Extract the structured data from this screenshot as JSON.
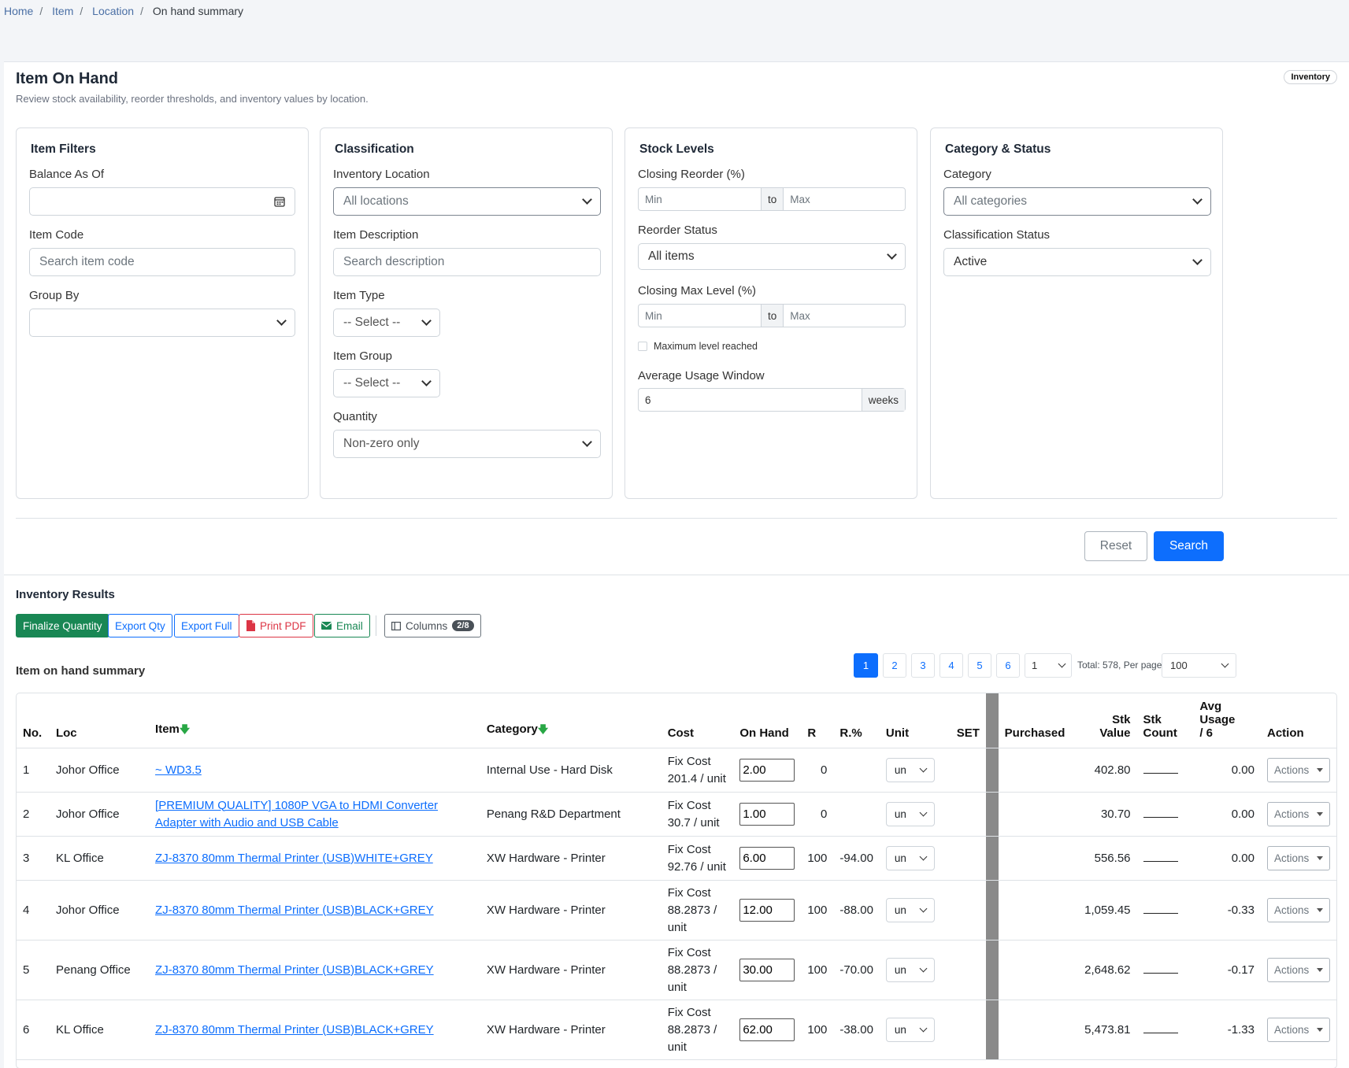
{
  "breadcrumb": [
    "Home",
    "Item",
    "Location",
    "On hand summary"
  ],
  "page": {
    "title": "Item On Hand",
    "subtitle": "Review stock availability, reorder thresholds, and inventory values by location.",
    "badge": "Inventory"
  },
  "filters": {
    "item": {
      "heading": "Item Filters",
      "balance_label": "Balance As Of",
      "balance_value": "",
      "code_label": "Item Code",
      "code_placeholder": "Search item code",
      "group_label": "Group By",
      "group_value": ""
    },
    "classification": {
      "heading": "Classification",
      "location_label": "Inventory Location",
      "location_value": "All locations",
      "desc_label": "Item Description",
      "desc_placeholder": "Search description",
      "type_label": "Item Type",
      "type_value": "-- Select --",
      "group_label": "Item Group",
      "group_value": "-- Select --",
      "qty_label": "Quantity",
      "qty_value": "Non-zero only"
    },
    "stock": {
      "heading": "Stock Levels",
      "reorder_label": "Closing Reorder (%)",
      "min": "Min",
      "to": "to",
      "max": "Max",
      "status_label": "Reorder Status",
      "status_value": "All items",
      "maxlevel_label": "Closing Max Level (%)",
      "max_reached_label": "Maximum level reached",
      "usage_label": "Average Usage Window",
      "usage_value": "6",
      "usage_unit": "weeks"
    },
    "category": {
      "heading": "Category & Status",
      "cat_label": "Category",
      "cat_value": "All categories",
      "status_label": "Classification Status",
      "status_value": "Active"
    },
    "reset": "Reset",
    "search": "Search"
  },
  "results": {
    "heading": "Inventory Results",
    "toolbar": {
      "finalize": "Finalize Quantity",
      "export_qty": "Export Qty",
      "export_full": "Export Full",
      "print_pdf": "Print PDF",
      "email": "Email",
      "columns": "Columns",
      "columns_count": "2/8"
    },
    "summary_title": "Item on hand summary",
    "pages": [
      "1",
      "2",
      "3",
      "4",
      "5",
      "6"
    ],
    "current_page": "1",
    "page_select": "1",
    "total_text": "Total: 578, Per page:",
    "per_page": "100",
    "columns": [
      "No.",
      "Loc",
      "Item",
      "Category",
      "Cost",
      "On Hand",
      "R",
      "R.%",
      "Unit",
      "SET",
      "Purchased",
      "Stk Value",
      "Stk Count",
      "Avg Usage / 6",
      "Action"
    ],
    "rows": [
      {
        "no": "1",
        "loc": "Johor Office",
        "item": "~ WD3.5",
        "category": "Internal Use - Hard Disk",
        "cost": "Fix Cost 201.4 / unit",
        "onhand": "2.00",
        "r": "0",
        "rp": "",
        "unit": "un",
        "stk_value": "402.80",
        "avg": "0.00",
        "action": "Actions"
      },
      {
        "no": "2",
        "loc": "Johor Office",
        "item": "[PREMIUM QUALITY] 1080P VGA to HDMI Converter Adapter with Audio and USB Cable",
        "category": "Penang R&D Department",
        "cost": "Fix Cost 30.7 / unit",
        "onhand": "1.00",
        "r": "0",
        "rp": "",
        "unit": "un",
        "stk_value": "30.70",
        "avg": "0.00",
        "action": "Actions"
      },
      {
        "no": "3",
        "loc": "KL Office",
        "item": "ZJ-8370 80mm Thermal Printer (USB)WHITE+GREY",
        "category": "XW Hardware - Printer",
        "cost": "Fix Cost 92.76 / unit",
        "onhand": "6.00",
        "r": "100",
        "rp": "-94.00",
        "unit": "un",
        "stk_value": "556.56",
        "avg": "0.00",
        "action": "Actions"
      },
      {
        "no": "4",
        "loc": "Johor Office",
        "item": "ZJ-8370 80mm Thermal Printer (USB)BLACK+GREY",
        "category": "XW Hardware - Printer",
        "cost": "Fix Cost 88.2873 / unit",
        "onhand": "12.00",
        "r": "100",
        "rp": "-88.00",
        "unit": "un",
        "stk_value": "1,059.45",
        "avg": "-0.33",
        "action": "Actions"
      },
      {
        "no": "5",
        "loc": "Penang Office",
        "item": "ZJ-8370 80mm Thermal Printer (USB)BLACK+GREY",
        "category": "XW Hardware - Printer",
        "cost": "Fix Cost 88.2873 / unit",
        "onhand": "30.00",
        "r": "100",
        "rp": "-70.00",
        "unit": "un",
        "stk_value": "2,648.62",
        "avg": "-0.17",
        "action": "Actions"
      },
      {
        "no": "6",
        "loc": "KL Office",
        "item": "ZJ-8370 80mm Thermal Printer (USB)BLACK+GREY",
        "category": "XW Hardware - Printer",
        "cost": "Fix Cost 88.2873 / unit",
        "onhand": "62.00",
        "r": "100",
        "rp": "-38.00",
        "unit": "un",
        "stk_value": "5,473.81",
        "avg": "-1.33",
        "action": "Actions"
      }
    ]
  }
}
